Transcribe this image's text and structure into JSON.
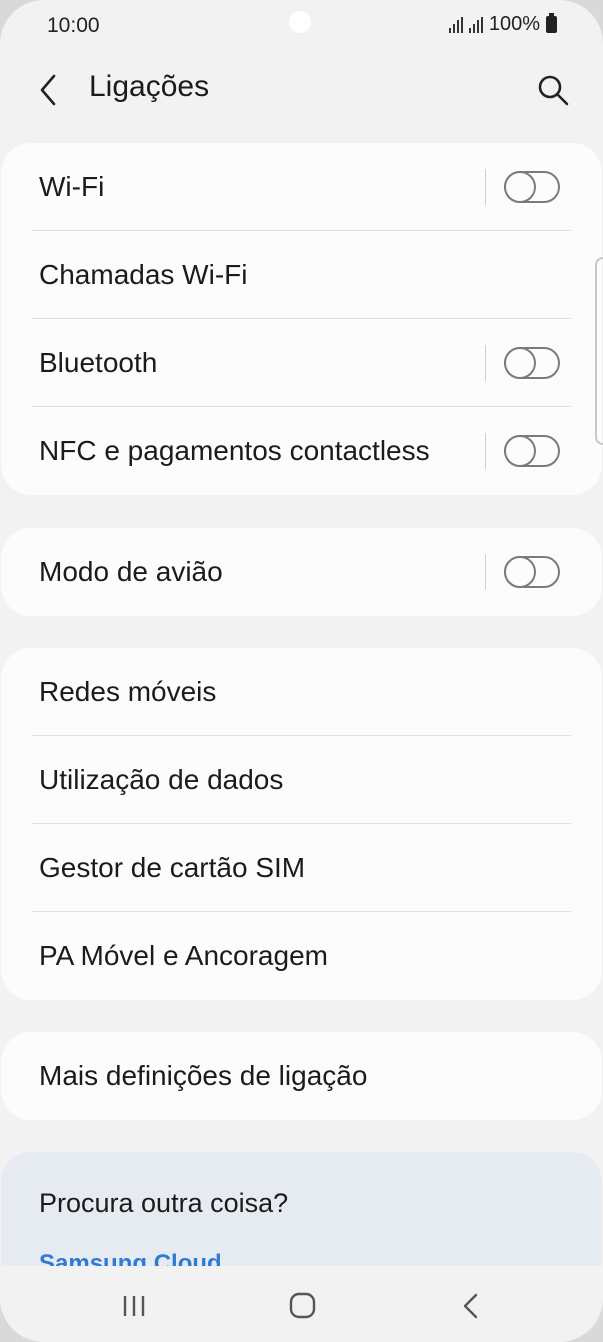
{
  "status_bar": {
    "time": "10:00",
    "battery": "100%"
  },
  "header": {
    "title": "Ligações"
  },
  "groups": [
    {
      "items": [
        {
          "label": "Wi-Fi",
          "toggle": false
        },
        {
          "label": "Chamadas Wi-Fi"
        },
        {
          "label": "Bluetooth",
          "toggle": false
        },
        {
          "label": "NFC e pagamentos contactless",
          "toggle": false
        }
      ]
    },
    {
      "items": [
        {
          "label": "Modo de avião",
          "toggle": false
        }
      ]
    },
    {
      "items": [
        {
          "label": "Redes móveis"
        },
        {
          "label": "Utilização de dados"
        },
        {
          "label": "Gestor de cartão SIM"
        },
        {
          "label": "PA Móvel e Ancoragem"
        }
      ]
    },
    {
      "items": [
        {
          "label": "Mais definições de ligação"
        }
      ]
    }
  ],
  "suggestions": {
    "question": "Procura outra coisa?",
    "link": "Samsung Cloud"
  },
  "icons": {
    "back": "chevron-left-icon",
    "search": "magnifier-icon",
    "nav_recents": "recents-icon",
    "nav_home": "home-icon",
    "nav_back": "back-icon"
  },
  "colors": {
    "background": "#f2f2f2",
    "card": "#fcfcfc",
    "suggest_bg": "#e6ebf1",
    "link": "#2f7ad6"
  }
}
